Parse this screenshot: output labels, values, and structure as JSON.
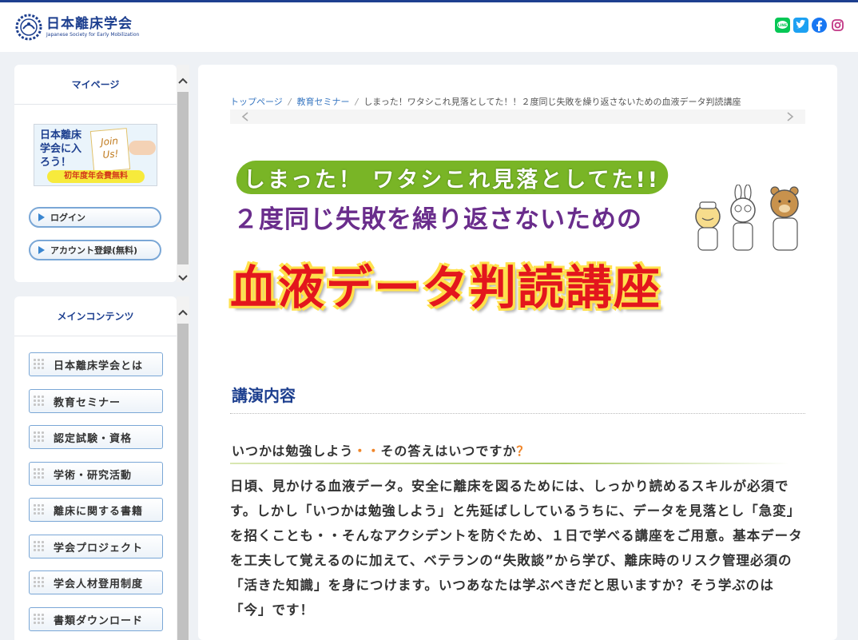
{
  "site": {
    "name_jp": "日本離床学会",
    "name_en": "Japanese Society for Early Mobilization"
  },
  "sns": [
    {
      "icon": "line-icon",
      "color": "#06c755"
    },
    {
      "icon": "twitter-icon",
      "color": "#1da1f2"
    },
    {
      "icon": "facebook-icon",
      "color": "#1877f2"
    },
    {
      "icon": "instagram-icon",
      "color": "#c13584"
    }
  ],
  "sidebar": {
    "mypage": {
      "title": "マイページ",
      "join_banner": {
        "text": "日本離床学会に入ろう！",
        "card": "Join Us!",
        "free": "初年度年会費無料"
      },
      "login": "ログイン",
      "register": "アカウント登録(無料)"
    },
    "main_contents": {
      "title": "メインコンテンツ",
      "items": [
        "日本離床学会とは",
        "教育セミナー",
        "認定試験・資格",
        "学術・研究活動",
        "離床に関する書籍",
        "学会プロジェクト",
        "学会人材登用制度",
        "書類ダウンロード"
      ]
    }
  },
  "breadcrumb": {
    "home": "トップページ",
    "category": "教育セミナー",
    "current": "しまった！ワタシこれ見落としてた！！２度同じ失敗を繰り返さないための血液データ判読講座"
  },
  "banner": {
    "line1": "しまった！ ワタシこれ見落としてた!!",
    "line2": "２度同じ失敗を繰り返さないための",
    "line3": "血液データ判読講座"
  },
  "content": {
    "section_title": "講演内容",
    "subtitle_a": "いつかは勉強しよう",
    "subtitle_dots": "・・",
    "subtitle_b": "その答えはいつですか",
    "subtitle_q": "？",
    "body": "日頃、見かける血液データ。安全に離床を図るためには、しっかり読めるスキルが必須です。しかし「いつかは勉強しよう」と先延ばししているうちに、データを見落とし「急変」を招くことも・・そんなアクシデントを防ぐため、１日で学べる講座をご用意。基本データを工夫して覚えるのに加えて、ベテランの“失敗談”から学び、離床時のリスク管理必須の「活きた知識」を身につけます。いつあなたは学ぶべきだと思いますか？そう学ぶのは「今」です！"
  },
  "colors": {
    "brand": "#1d3f8f",
    "accent_green": "#79b526",
    "banner_purple": "#6a2d8c",
    "banner_red": "#e3161d"
  }
}
